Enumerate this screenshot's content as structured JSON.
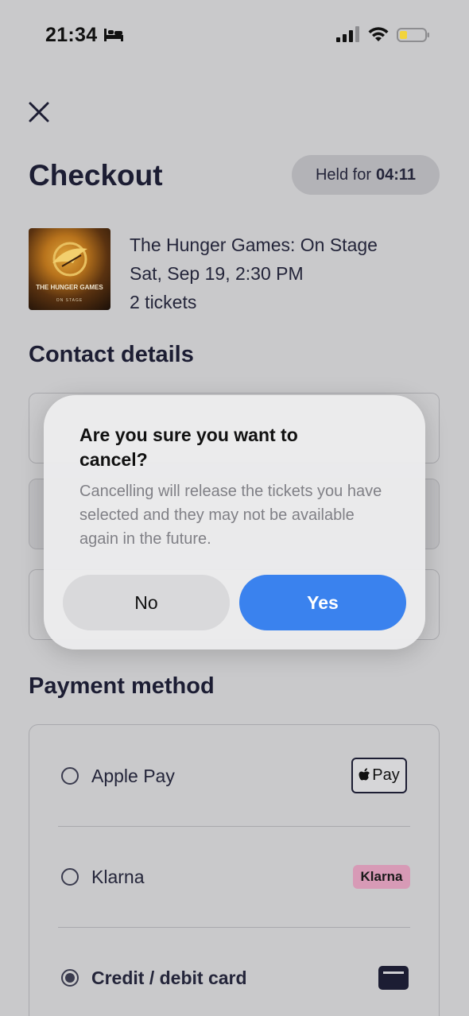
{
  "status_bar": {
    "time": "21:34"
  },
  "header": {
    "title": "Checkout",
    "held_prefix": "Held for",
    "held_timer": "04:11"
  },
  "event": {
    "poster_title": "THE HUNGER GAMES",
    "poster_subtitle": "ON STAGE",
    "name": "The Hunger Games: On Stage",
    "datetime": "Sat, Sep 19, 2:30 PM",
    "tickets": "2 tickets"
  },
  "contact": {
    "title": "Contact details"
  },
  "payment": {
    "title": "Payment method",
    "options": [
      {
        "label": "Apple Pay",
        "badge": "Pay",
        "selected": false
      },
      {
        "label": "Klarna",
        "badge": "Klarna",
        "selected": false
      },
      {
        "label": "Credit / debit card",
        "badge": "",
        "selected": true
      }
    ]
  },
  "dialog": {
    "title": "Are you sure you want to cancel?",
    "message": "Cancelling will release the tickets you have selected and they may not be available again in the future.",
    "no_label": "No",
    "yes_label": "Yes"
  },
  "colors": {
    "accent": "#3a82ee",
    "klarna": "#d79ab6",
    "text_dark": "#1c1d33"
  }
}
